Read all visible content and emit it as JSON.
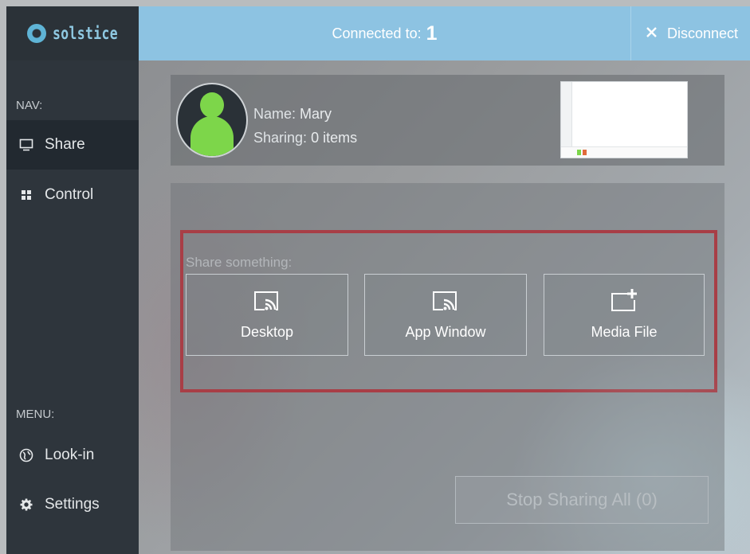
{
  "brand": {
    "name": "solstice"
  },
  "sidebar": {
    "nav_heading": "NAV:",
    "nav_items": [
      {
        "label": "Share",
        "icon": "monitor-icon",
        "active": true
      },
      {
        "label": "Control",
        "icon": "grid-icon",
        "active": false
      }
    ],
    "menu_heading": "MENU:",
    "menu_items": [
      {
        "label": "Look-in",
        "icon": "globe-icon"
      },
      {
        "label": "Settings",
        "icon": "gear-icon"
      }
    ]
  },
  "header": {
    "connected_label": "Connected to:",
    "connected_count": "1",
    "disconnect_label": "Disconnect"
  },
  "user": {
    "name_label": "Name:",
    "name": "Mary",
    "sharing_label": "Sharing:",
    "sharing_value": "0 items"
  },
  "share": {
    "title": "Share something:",
    "options": [
      {
        "label": "Desktop",
        "icon": "cast-icon"
      },
      {
        "label": "App Window",
        "icon": "cast-icon"
      },
      {
        "label": "Media File",
        "icon": "add-file-icon"
      }
    ],
    "stop_label": "Stop Sharing All (0)"
  },
  "colors": {
    "header_bg": "#8dc3e2",
    "sidebar_bg": "#2e353c",
    "avatar_green": "#7dd64a",
    "highlight_red": "#d8131e"
  }
}
